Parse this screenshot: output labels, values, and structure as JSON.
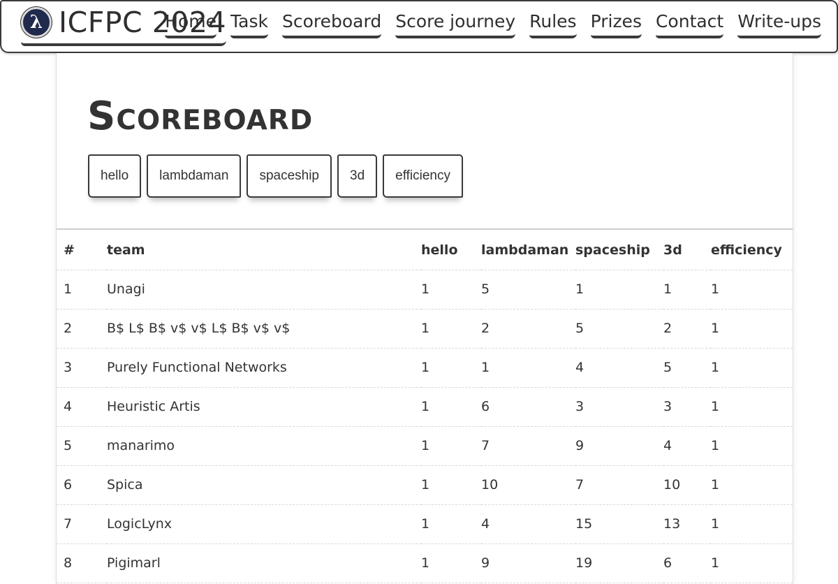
{
  "nav": {
    "logo_glyph": "λ",
    "title": "ICFPC 2024",
    "links": [
      "Home",
      "Task",
      "Scoreboard",
      "Score journey",
      "Rules",
      "Prizes",
      "Contact",
      "Write-ups"
    ]
  },
  "page": {
    "title": "Scoreboard",
    "task_buttons": [
      "hello",
      "lambdaman",
      "spaceship",
      "3d",
      "efficiency"
    ]
  },
  "table": {
    "headers": [
      "#",
      "team",
      "hello",
      "lambdaman",
      "spaceship",
      "3d",
      "efficiency"
    ],
    "rows": [
      [
        "1",
        "Unagi",
        "1",
        "5",
        "1",
        "1",
        "1"
      ],
      [
        "2",
        "B$ L$ B$ v$ v$ L$ B$ v$ v$",
        "1",
        "2",
        "5",
        "2",
        "1"
      ],
      [
        "3",
        "Purely Functional Networks",
        "1",
        "1",
        "4",
        "5",
        "1"
      ],
      [
        "4",
        "Heuristic Artis",
        "1",
        "6",
        "3",
        "3",
        "1"
      ],
      [
        "5",
        "manarimo",
        "1",
        "7",
        "9",
        "4",
        "1"
      ],
      [
        "6",
        "Spica",
        "1",
        "10",
        "7",
        "10",
        "1"
      ],
      [
        "7",
        "LogicLynx",
        "1",
        "4",
        "15",
        "13",
        "1"
      ],
      [
        "8",
        "Pigimarl",
        "1",
        "9",
        "19",
        "6",
        "1"
      ]
    ]
  },
  "colors": {
    "ink": "#2f2f2f",
    "logo_bg": "#1f2a4c",
    "divider": "#cfcfcf"
  }
}
